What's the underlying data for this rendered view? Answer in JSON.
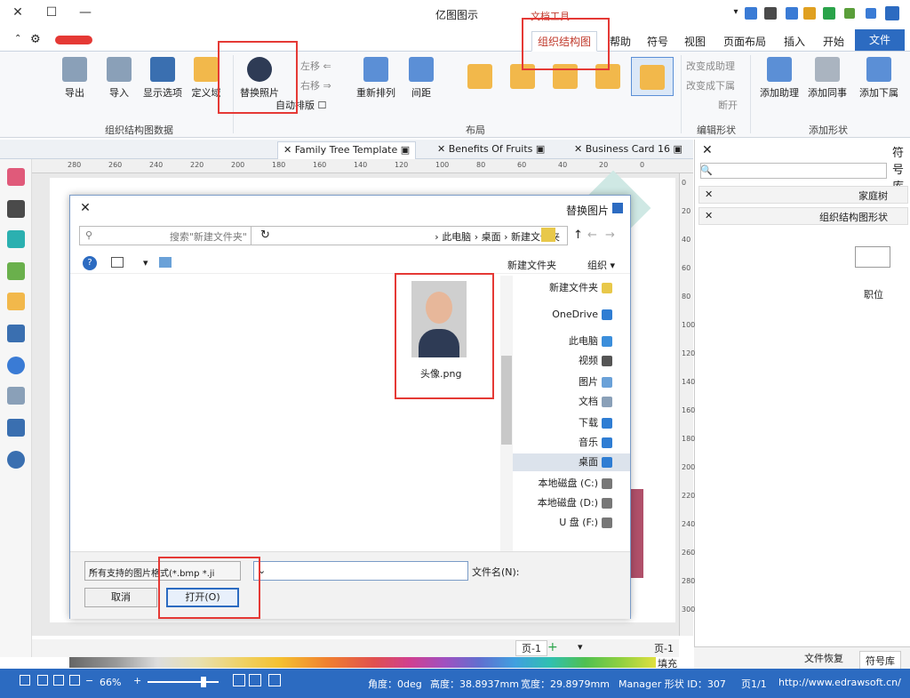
{
  "window": {
    "title": "亿图图示",
    "min_glyph": "—",
    "max_glyph": "☐",
    "close_glyph": "✕"
  },
  "ribbon_tabs": {
    "file": "文件",
    "start": "开始",
    "insert": "插入",
    "layout": "页面布局",
    "view": "视图",
    "symbol": "符号",
    "help": "帮助",
    "org": "组织结构图",
    "tools_title": "文档工具"
  },
  "ribbon": {
    "add_shape": {
      "add_sub": "添加下属",
      "add_peer": "添加同事",
      "add_assistant": "添加助理",
      "label": "添加形状"
    },
    "edit_shape": {
      "assistant": "改变成助理",
      "subordinate": "改变成下属",
      "break": "断开",
      "label": "编辑形状"
    },
    "layout": {
      "spacing": "间距",
      "rearrange": "重新排列",
      "left": "左移",
      "right": "右移",
      "auto_arrange": "自动排版",
      "label": "布局"
    },
    "data": {
      "replace_photo": "替换照片",
      "custom": "定义域",
      "display_options": "显示选项",
      "import": "导入",
      "export": "导出",
      "label": "组织结构图数据"
    }
  },
  "doc_tabs": [
    "Family Tree Template",
    "Benefits Of Fruits",
    "Business Card 16"
  ],
  "ruler": {
    "h_ticks": [
      "280",
      "260",
      "240",
      "220",
      "200",
      "180",
      "160",
      "140",
      "120",
      "100",
      "80",
      "60",
      "40",
      "20",
      "0"
    ],
    "v_ticks": [
      "0",
      "20",
      "40",
      "60",
      "80",
      "100",
      "120",
      "140",
      "160",
      "180",
      "200",
      "220",
      "240",
      "260",
      "280",
      "300"
    ]
  },
  "right_panel": {
    "title": "符号库",
    "categories": [
      "家庭树",
      "组织结构图形状"
    ],
    "shape_label": "职位",
    "tabs": [
      "符号库",
      "文件恢复"
    ]
  },
  "dialog": {
    "title": "替换图片",
    "address": [
      "此电脑",
      "桌面",
      "新建文件夹"
    ],
    "search_placeholder": "搜索\"新建文件夹\"",
    "organize": "组织",
    "new_folder": "新建文件夹",
    "file_name": "头像.png",
    "filename_label": "文件名(N):",
    "filter": "所有支持的图片格式(*.bmp *.ji",
    "open": "打开(O)",
    "cancel": "取消",
    "nav_items": [
      {
        "label": "新建文件夹",
        "color": "#e8c84a"
      },
      {
        "label": "OneDrive",
        "color": "#2f7dd3"
      },
      {
        "label": "此电脑",
        "color": "#3b8edb"
      },
      {
        "label": "视频",
        "color": "#555555"
      },
      {
        "label": "图片",
        "color": "#6aa1d8"
      },
      {
        "label": "文档",
        "color": "#8aa0b8"
      },
      {
        "label": "下载",
        "color": "#2f7dd3"
      },
      {
        "label": "音乐",
        "color": "#2f7dd3"
      },
      {
        "label": "桌面",
        "color": "#2f7dd3"
      },
      {
        "label": "本地磁盘 (C:)",
        "color": "#777777"
      },
      {
        "label": "本地磁盘 (D:)",
        "color": "#777777"
      },
      {
        "label": "U 盘 (F:)",
        "color": "#777777"
      }
    ]
  },
  "page_bar": {
    "page_label": "页-1",
    "page_tab": "页-1",
    "fill_label": "填充"
  },
  "status": {
    "url": "http://www.edrawsoft.cn/",
    "page": "页1/1",
    "shape": "Manager 形状 ID：307",
    "width": "宽度：29.8979mm",
    "height": "高度：38.8937mm",
    "angle": "角度：0deg",
    "zoom": "66%"
  },
  "colors": {
    "accent": "#2c6bc1",
    "highlight": "#e53935"
  }
}
